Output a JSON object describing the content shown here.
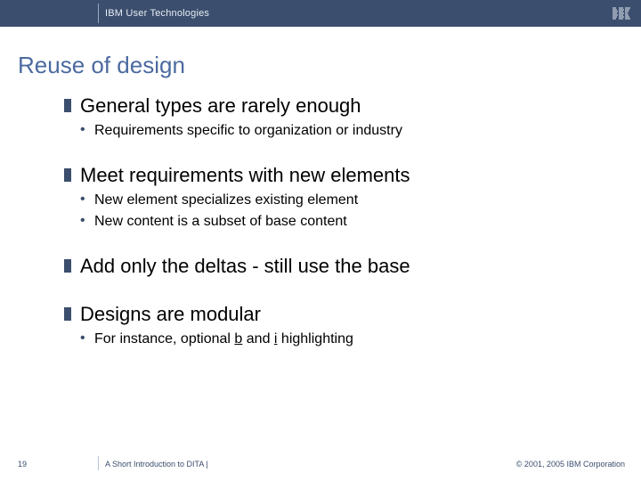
{
  "header": {
    "org_label": "IBM User Technologies"
  },
  "title": "Reuse of design",
  "bullets": [
    {
      "heading": "General types are rarely enough",
      "subs": [
        "Requirements specific to organization or industry"
      ]
    },
    {
      "heading": "Meet requirements with new elements",
      "subs": [
        "New element specializes existing element",
        "New content is a subset of base content"
      ]
    },
    {
      "heading": "Add only the deltas - still use the base",
      "subs": []
    },
    {
      "heading": "Designs are modular",
      "subs_html": [
        "For instance, optional <span class=\"ul\">b</span> and <span class=\"ul\">i</span> highlighting"
      ]
    }
  ],
  "footer": {
    "page": "19",
    "doc_title": "A Short Introduction to DITA |",
    "copyright": "© 2001, 2005 IBM Corporation"
  }
}
